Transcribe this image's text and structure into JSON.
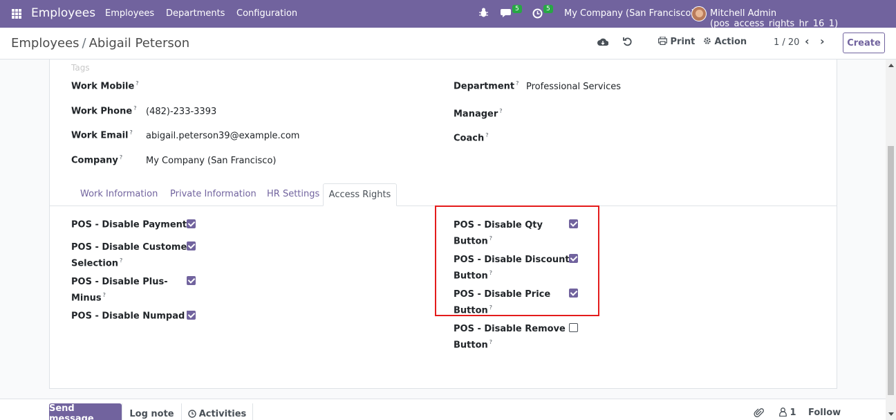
{
  "navbar": {
    "app_name": "Employees",
    "menu": [
      "Employees",
      "Departments",
      "Configuration"
    ],
    "bug_icon": "bug-icon",
    "messages_count": "5",
    "activities_count": "5",
    "company": "My Company (San Francisco)",
    "user": "Mitchell Admin (pos_access_rights_hr_16_1)"
  },
  "control_panel": {
    "breadcrumb_parent": "Employees",
    "breadcrumb_sep": "/",
    "breadcrumb_current": "Abigail Peterson",
    "print_label": "Print",
    "action_label": "Action",
    "pager": "1 / 20",
    "create_label": "Create"
  },
  "form": {
    "tags_placeholder": "Tags",
    "left_fields": [
      {
        "label": "Work Mobile",
        "value": ""
      },
      {
        "label": "Work Phone",
        "value": "(482)-233-3393"
      },
      {
        "label": "Work Email",
        "value": "abigail.peterson39@example.com"
      },
      {
        "label": "Company",
        "value": "My Company (San Francisco)"
      }
    ],
    "right_fields": [
      {
        "label": "Department",
        "value": "Professional Services"
      },
      {
        "label": "Manager",
        "value": ""
      },
      {
        "label": "Coach",
        "value": ""
      }
    ],
    "tooltip_mark": "?"
  },
  "tabs": [
    "Work Information",
    "Private Information",
    "HR Settings",
    "Access Rights"
  ],
  "access_rights": {
    "left": [
      {
        "line1": "POS - Disable Payment",
        "line2": "",
        "checked": true
      },
      {
        "line1": "POS - Disable Customer",
        "line2": "Selection",
        "checked": true
      },
      {
        "line1": "POS - Disable Plus-",
        "line2": "Minus",
        "checked": true
      },
      {
        "line1": "POS - Disable Numpad",
        "line2": "",
        "checked": true
      }
    ],
    "right": [
      {
        "line1": "POS - Disable Qty",
        "line2": "Button",
        "checked": true
      },
      {
        "line1": "POS - Disable Discount",
        "line2": "Button",
        "checked": true
      },
      {
        "line1": "POS - Disable Price",
        "line2": "Button",
        "checked": true
      },
      {
        "line1": "POS - Disable Remove",
        "line2": "Button",
        "checked": false
      }
    ]
  },
  "chatter": {
    "send_message": "Send message",
    "log_note": "Log note",
    "activities": "Activities",
    "followers_count": "1",
    "follow": "Follow"
  },
  "colors": {
    "brand": "#71639e",
    "highlight": "#e41b1b",
    "badge": "#28a745"
  }
}
